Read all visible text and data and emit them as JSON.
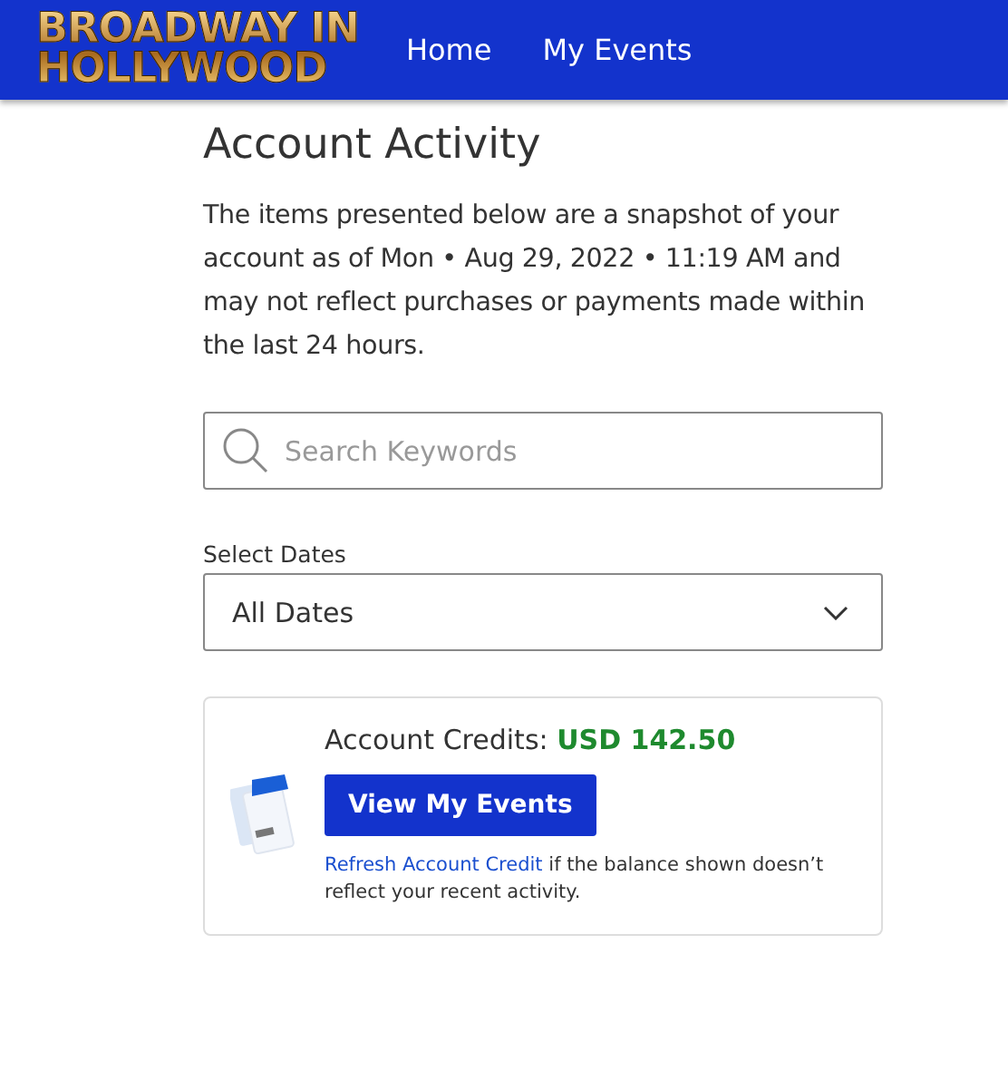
{
  "header": {
    "logo": [
      "BROADWAY IN",
      "HOLLYWOOD"
    ],
    "nav": [
      {
        "label": "Home"
      },
      {
        "label": "My Events"
      }
    ]
  },
  "title": "Account Activity",
  "intro": "The items presented below are a snapshot of your account as of Mon • Aug 29, 2022 • 11:19 AM and may not reflect purchases or payments made within the last 24 hours.",
  "search": {
    "placeholder": "Search Keywords"
  },
  "date_select": {
    "label": "Select Dates",
    "value": "All Dates"
  },
  "credits": {
    "label": "Account Credits:",
    "amount": "USD 142.50",
    "button": "View My Events",
    "refresh_link": "Refresh Account Credit",
    "refresh_text": "if the balance shown doesn’t reflect your recent activity."
  }
}
